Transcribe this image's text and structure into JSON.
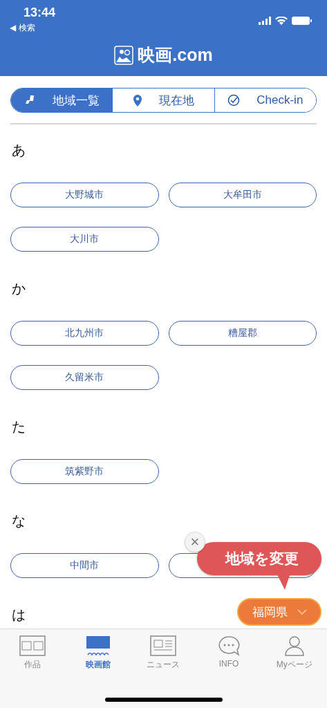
{
  "status_bar": {
    "time": "13:44",
    "back_label": "◀ 検索"
  },
  "header": {
    "logo_text": "映画.com"
  },
  "segments": [
    {
      "label": "地域一覧",
      "selected": true
    },
    {
      "label": "現在地",
      "selected": false
    },
    {
      "label": "Check-in",
      "selected": false
    }
  ],
  "sections": [
    {
      "heading": "あ",
      "chips": [
        {
          "label": "大野城市"
        },
        {
          "label": "大牟田市"
        },
        {
          "label": "大川市"
        }
      ]
    },
    {
      "heading": "か",
      "chips": [
        {
          "label": "北九州市"
        },
        {
          "label": "糟屋郡"
        },
        {
          "label": "久留米市"
        }
      ]
    },
    {
      "heading": "た",
      "chips": [
        {
          "label": "筑紫野市"
        }
      ]
    },
    {
      "heading": "な",
      "chips": [
        {
          "label": "中間市"
        },
        {
          "kind": "covered"
        }
      ]
    },
    {
      "heading": "は"
    }
  ],
  "tooltip": {
    "text": "地域を変更",
    "close": "×"
  },
  "prefecture_button": {
    "label": "福岡県"
  },
  "tab_bar": [
    {
      "label": "作品",
      "selected": false
    },
    {
      "label": "映画館",
      "selected": true
    },
    {
      "label": "ニュース",
      "selected": false
    },
    {
      "label": "INFO",
      "selected": false
    },
    {
      "label": "Myページ",
      "selected": false
    }
  ]
}
